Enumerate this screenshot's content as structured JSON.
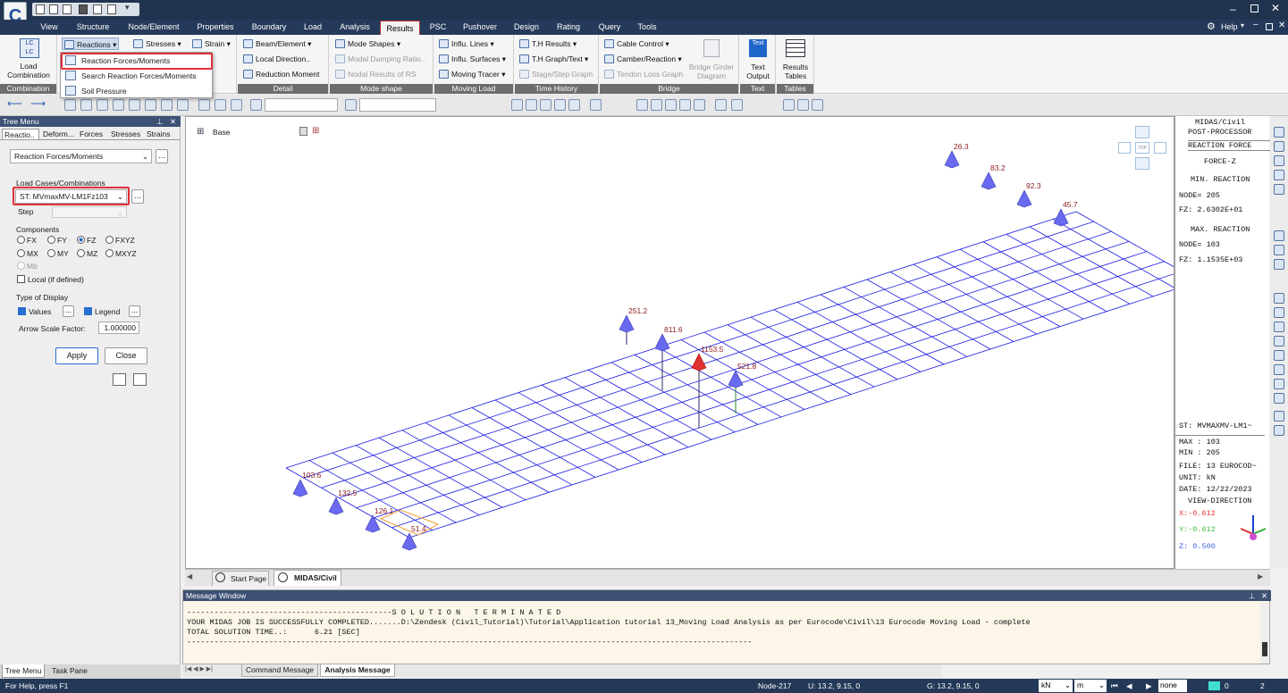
{
  "app": {
    "help": "Help"
  },
  "menu": {
    "tabs": [
      "View",
      "Structure",
      "Node/Element",
      "Properties",
      "Boundary",
      "Load",
      "Analysis",
      "Results",
      "PSC",
      "Pushover",
      "Design",
      "Rating",
      "Query",
      "Tools"
    ],
    "active": "Results"
  },
  "ribbon": {
    "load_combination": {
      "label": "Load",
      "label2": "Combination",
      "group": "Combination"
    },
    "reactions": "Reactions",
    "stresses": "Stresses",
    "strain": "Strain",
    "detail": {
      "items": [
        "Beam/Element",
        "Local Direction..",
        "Reduction Moment"
      ],
      "group": "Detail"
    },
    "mode_shape": {
      "items": [
        "Mode Shapes",
        "Modal Damping Ratio..",
        "Nodal Results of RS"
      ],
      "group": "Mode shape"
    },
    "moving_load": {
      "items": [
        "Influ. Lines",
        "Influ. Surfaces",
        "Moving Tracer"
      ],
      "group": "Moving Load"
    },
    "time_history": {
      "items": [
        "T.H Results",
        "T.H Graph/Text",
        "Stage/Step Graph"
      ],
      "group": "Time History"
    },
    "bridge": {
      "items": [
        "Cable Control",
        "Camber/Reaction",
        "Tendon Loss Graph"
      ],
      "girder": "Bridge Girder",
      "girder2": "Diagram",
      "group": "Bridge"
    },
    "text": {
      "icon": "Text",
      "label": "Text",
      "label2": "Output",
      "group": "Text"
    },
    "tables": {
      "label": "Results",
      "label2": "Tables",
      "group": "Tables"
    }
  },
  "reactions_menu": [
    "Reaction Forces/Moments",
    "Search Reaction Forces/Moments",
    "Soil Pressure"
  ],
  "tree": {
    "title": "Tree Menu",
    "tabs": [
      "Reactio..",
      "Deform...",
      "Forces",
      "Stresses",
      "Strains"
    ],
    "type_select": "Reaction Forces/Moments",
    "load_cases_label": "Load Cases/Combinations",
    "load_case": "ST: MVmaxMV-LM1Fz103",
    "step_label": "Step",
    "components_label": "Components",
    "components": [
      "FX",
      "FY",
      "FZ",
      "FXYZ",
      "MX",
      "MY",
      "MZ",
      "MXYZ",
      "Mb"
    ],
    "selected_component": "FZ",
    "local": "Local (if defined)",
    "display_label": "Type of Display",
    "values": "Values",
    "legend": "Legend",
    "arrow_scale_label": "Arrow Scale Factor:",
    "arrow_scale": "1.000000",
    "apply": "Apply",
    "close": "Close",
    "more": "..."
  },
  "viewport": {
    "base": "Base",
    "compass": "TOP",
    "reactions": [
      {
        "label": "26.3"
      },
      {
        "label": "83.2"
      },
      {
        "label": "92.3"
      },
      {
        "label": "45.7"
      },
      {
        "label": "251.2"
      },
      {
        "label": "811.6"
      },
      {
        "label": "1153.5"
      },
      {
        "label": "521.8"
      },
      {
        "label": "103.6"
      },
      {
        "label": "132.5"
      },
      {
        "label": "126.1"
      },
      {
        "label": "51.4"
      }
    ],
    "colors": {
      "mesh": "#1b1be0",
      "arrow": "#6a6af0",
      "max_arrow": "#e03030",
      "label": "#8b1a1a"
    }
  },
  "info": {
    "l1": "MIDAS/Civil",
    "l2": "POST-PROCESSOR",
    "l3": "REACTION FORCE",
    "l4": "FORCE-Z",
    "min_title": "MIN. REACTION",
    "min_node": "NODE=   205",
    "min_fz": "FZ:   2.6302E+01",
    "max_title": "MAX. REACTION",
    "max_node": "NODE=   103",
    "max_fz": "FZ:  1.1535E+03",
    "st": "ST: MVMAXMV-LM1~",
    "max": "MAX : 103",
    "min": "MIN : 205",
    "file": "FILE: 13 EUROCOD~",
    "unit": "UNIT: kN",
    "date": "DATE: 12/22/2023",
    "view": "VIEW-DIRECTION",
    "vx": "X:-0.612",
    "vy": "Y:-0.612",
    "vz": "Z: 0.500"
  },
  "doc_tabs": [
    "Start Page",
    "MIDAS/Civil"
  ],
  "message": {
    "title": "Message Window",
    "lines": [
      "---------------------------------------------S O L U T I O N   T E R M I N A T E D",
      "YOUR MIDAS JOB IS SUCCESSFULLY COMPLETED.......D:\\Zendesk (Civil_Tutorial)\\Tutorial\\Application tutorial 13_Moving Load Analysis as per Eurocode\\Civil\\13 Eurocode Moving Load - complete",
      "TOTAL SOLUTION TIME..:      6.21 [SEC]",
      "----------------------------------------------------------------------------------------------------------------------------"
    ],
    "tabs": [
      "Command Message",
      "Analysis Message"
    ]
  },
  "bottom_tabs": [
    "Tree Menu",
    "Task Pane"
  ],
  "status": {
    "help": "For Help, press F1",
    "node": "Node-217",
    "u": "U: 13.2, 9.15, 0",
    "g": "G: 13.2, 9.15, 0",
    "unit": "kN",
    "length": "m",
    "none": "none",
    "page": "0",
    "total": "2"
  }
}
